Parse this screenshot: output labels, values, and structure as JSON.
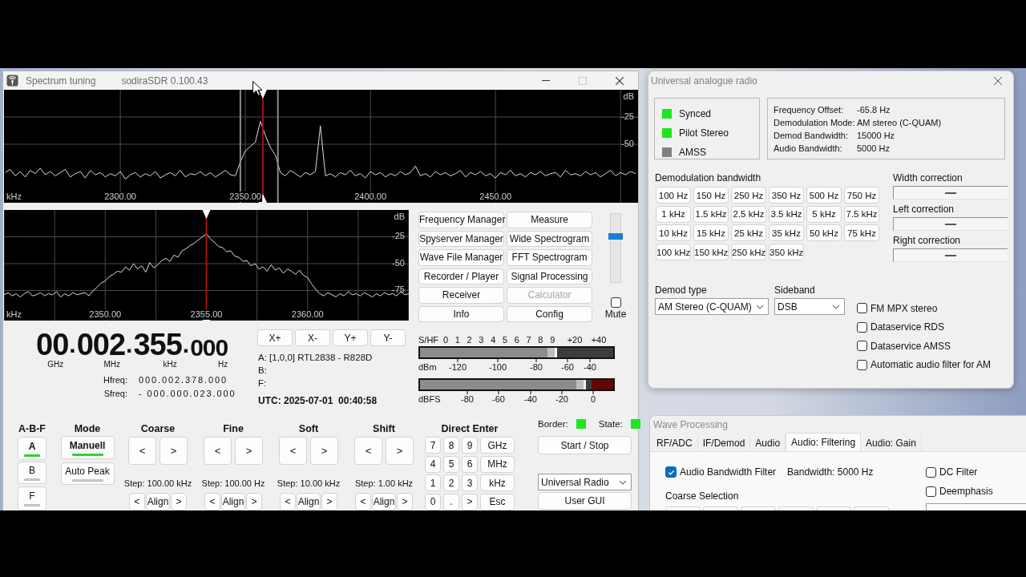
{
  "spectrum_window": {
    "title": "Spectrum tuning",
    "version": "sodiraSDR 0.100.43",
    "window_buttons": [
      {
        "kind": "minimize",
        "disabled": false
      },
      {
        "kind": "maximize",
        "disabled": true
      },
      {
        "kind": "close",
        "disabled": false
      }
    ],
    "wide_spectrum": {
      "chart_data": [
        {
          "type": "line",
          "xlabel": "kHz",
          "ylabel": "dB",
          "xlim": [
            2253.5,
            2507
          ],
          "ylim": [
            -103.7,
            0
          ],
          "xticks": [
            {
              "value": 2300,
              "label": "2300.00"
            },
            {
              "value": 2350,
              "label": "2350.00"
            },
            {
              "value": 2400,
              "label": "2400.00"
            },
            {
              "value": 2450,
              "label": "2450.00"
            }
          ],
          "yticks": [
            -25,
            -50
          ],
          "grid": true,
          "color": "#dcdcdc",
          "ref_lines": [
            {
              "axis": "x",
              "value": 2357,
              "color": "#a51212"
            },
            {
              "axis": "x",
              "value": 2348,
              "color": "#8c8c8c"
            },
            {
              "axis": "x",
              "value": 2363,
              "color": "#8c8c8c"
            }
          ],
          "x": [
            2254,
            2256,
            2258,
            2260,
            2262,
            2264,
            2266,
            2268,
            2270,
            2272,
            2274,
            2276,
            2278,
            2280,
            2282,
            2284,
            2286,
            2288,
            2290,
            2292,
            2294,
            2296,
            2298,
            2300,
            2302,
            2304,
            2306,
            2308,
            2310,
            2312,
            2314,
            2316,
            2318,
            2320,
            2322,
            2324,
            2326,
            2328,
            2330,
            2332,
            2334,
            2336,
            2338,
            2340,
            2342,
            2344,
            2346,
            2348,
            2350,
            2352,
            2354,
            2356,
            2358,
            2360,
            2362,
            2364,
            2366,
            2368,
            2370,
            2372,
            2374,
            2376,
            2378,
            2380,
            2382,
            2384,
            2386,
            2388,
            2390,
            2392,
            2394,
            2396,
            2398,
            2400,
            2402,
            2404,
            2406,
            2408,
            2410,
            2412,
            2414,
            2416,
            2418,
            2420,
            2422,
            2424,
            2426,
            2428,
            2430,
            2432,
            2434,
            2436,
            2438,
            2440,
            2442,
            2444,
            2446,
            2448,
            2450,
            2452,
            2454,
            2456,
            2458,
            2460,
            2462,
            2464,
            2466,
            2468,
            2470,
            2472,
            2474,
            2476,
            2478,
            2480,
            2482,
            2484,
            2486,
            2488,
            2490,
            2492,
            2494,
            2496,
            2498,
            2500,
            2502,
            2504,
            2506
          ],
          "values": [
            -76,
            -73,
            -79,
            -75,
            -80,
            -74,
            -77,
            -72,
            -78,
            -75,
            -79,
            -76,
            -73,
            -80,
            -77,
            -75,
            -81,
            -74,
            -78,
            -76,
            -80,
            -77,
            -79,
            -75,
            -82,
            -78,
            -76,
            -80,
            -77,
            -79,
            -75,
            -81,
            -78,
            -76,
            -79,
            -74,
            -80,
            -77,
            -78,
            -75,
            -79,
            -76,
            -80,
            -77,
            -74,
            -78,
            -79,
            -66,
            -56,
            -52,
            -48,
            -29,
            -42,
            -53,
            -60,
            -76,
            -79,
            -74,
            -77,
            -80,
            -76,
            -78,
            -75,
            -33,
            -79,
            -77,
            -80,
            -76,
            -78,
            -74,
            -79,
            -77,
            -81,
            -75,
            -78,
            -76,
            -80,
            -77,
            -79,
            -75,
            -78,
            -76,
            -70,
            -79,
            -77,
            -80,
            -75,
            -78,
            -76,
            -79,
            -77,
            -74,
            -80,
            -76,
            -78,
            -75,
            -79,
            -77,
            -81,
            -76,
            -78,
            -74,
            -79,
            -77,
            -80,
            -76,
            -78,
            -75,
            -79,
            -77,
            -76,
            -80,
            -74,
            -78,
            -77,
            -79,
            -75,
            -78,
            -76,
            -80,
            -77,
            -74,
            -79,
            -76,
            -78,
            -75,
            -77
          ]
        }
      ]
    },
    "zoom_spectrum": {
      "chart_data": [
        {
          "type": "line",
          "xlabel": "kHz",
          "ylabel": "dB",
          "xlim": [
            2345,
            2365
          ],
          "ylim": [
            -103,
            0
          ],
          "xticks": [
            {
              "value": 2350,
              "label": "2350.00"
            },
            {
              "value": 2355,
              "label": "2355.00"
            },
            {
              "value": 2360,
              "label": "2360.00"
            }
          ],
          "yticks": [
            -25,
            -50,
            -75
          ],
          "grid": true,
          "color": "#dcdcdc",
          "ref_lines": [
            {
              "axis": "x",
              "value": 2355,
              "color": "#a51212"
            }
          ],
          "x": [
            2345,
            2345.2,
            2345.4,
            2345.6,
            2345.8,
            2346,
            2346.2,
            2346.4,
            2346.6,
            2346.8,
            2347,
            2347.2,
            2347.4,
            2347.6,
            2347.8,
            2348,
            2348.2,
            2348.4,
            2348.6,
            2348.8,
            2349,
            2349.2,
            2349.4,
            2349.6,
            2349.8,
            2350,
            2350.2,
            2350.4,
            2350.6,
            2350.8,
            2351,
            2351.2,
            2351.4,
            2351.6,
            2351.8,
            2352,
            2352.2,
            2352.4,
            2352.6,
            2352.8,
            2353,
            2353.2,
            2353.4,
            2353.6,
            2353.8,
            2354,
            2354.2,
            2354.4,
            2354.6,
            2354.8,
            2355,
            2355.2,
            2355.4,
            2355.6,
            2355.8,
            2356,
            2356.2,
            2356.4,
            2356.6,
            2356.8,
            2357,
            2357.2,
            2357.4,
            2357.6,
            2357.8,
            2358,
            2358.2,
            2358.4,
            2358.6,
            2358.8,
            2359,
            2359.2,
            2359.4,
            2359.6,
            2359.8,
            2360,
            2360.2,
            2360.4,
            2360.6,
            2360.8,
            2361,
            2361.2,
            2361.4,
            2361.6,
            2361.8,
            2362,
            2362.2,
            2362.4,
            2362.6,
            2362.8,
            2363,
            2363.2,
            2363.4,
            2363.6,
            2363.8,
            2364,
            2364.2,
            2364.4,
            2364.6,
            2364.8,
            2365
          ],
          "values": [
            -79,
            -77,
            -80,
            -78,
            -81,
            -78,
            -76,
            -80,
            -79,
            -77,
            -80,
            -78,
            -79,
            -76,
            -81,
            -78,
            -80,
            -77,
            -79,
            -78,
            -77,
            -80,
            -75,
            -72,
            -68,
            -66,
            -62,
            -60,
            -57,
            -58,
            -53,
            -56,
            -50,
            -55,
            -52,
            -58,
            -49,
            -54,
            -51,
            -47,
            -45,
            -48,
            -42,
            -44,
            -38,
            -36,
            -33,
            -31,
            -28,
            -25,
            -22,
            -27,
            -30,
            -34,
            -35,
            -39,
            -38,
            -43,
            -44,
            -48,
            -47,
            -52,
            -50,
            -55,
            -53,
            -57,
            -51,
            -56,
            -54,
            -59,
            -55,
            -57,
            -60,
            -56,
            -61,
            -63,
            -69,
            -74,
            -78,
            -80,
            -77,
            -79,
            -81,
            -78,
            -80,
            -76,
            -79,
            -78,
            -80,
            -77,
            -79,
            -81,
            -78,
            -80,
            -77,
            -79,
            -78,
            -80,
            -76,
            -79,
            -78
          ]
        }
      ]
    },
    "tool_buttons": [
      {
        "label": "Frequency Manager",
        "disabled": false
      },
      {
        "label": "Measure",
        "disabled": false
      },
      {
        "label": "Spyserver Manager",
        "disabled": false
      },
      {
        "label": "Wide Spectrogram",
        "disabled": false
      },
      {
        "label": "Wave File Manager",
        "disabled": false
      },
      {
        "label": "FFT Spectrogram",
        "disabled": false
      },
      {
        "label": "Recorder / Player",
        "disabled": false
      },
      {
        "label": "Signal Processing",
        "disabled": false
      },
      {
        "label": "Receiver",
        "disabled": false
      },
      {
        "label": "Calculator",
        "disabled": true
      },
      {
        "label": "Info",
        "disabled": false
      },
      {
        "label": "Config",
        "disabled": false
      }
    ],
    "volume": {
      "level": 0.7
    },
    "mute": {
      "label": "Mute",
      "checked": false
    },
    "frequency": [
      {
        "digits": "00",
        "separator": ".",
        "unit": "GHz"
      },
      {
        "digits": "002",
        "separator": ".",
        "unit": "MHz"
      },
      {
        "digits": "355",
        "separator": ".",
        "unit": "kHz"
      },
      {
        "digits": "000",
        "unit": "Hz"
      }
    ],
    "offsets": [
      {
        "label": "Hfreq:",
        "value": "000.002.378.000"
      },
      {
        "label": "Sfreq:",
        "value": "- 000.000.023.000"
      }
    ],
    "axis_buttons": [
      "X+",
      "X-",
      "Y+",
      "Y-"
    ],
    "devices": [
      "A: [1,0,0] RTL2838 - R828D",
      "B:",
      "F:"
    ],
    "utc": "UTC: 2025-07-01  00:40:58",
    "meters": [
      {
        "kind": "dbm",
        "scale_unit": "S/HF",
        "scale": [
          "0",
          "1",
          "2",
          "3",
          "4",
          "5",
          "6",
          "7",
          "8",
          "9",
          "+20",
          "+40"
        ],
        "unit": "dBm",
        "labels": [
          "-120",
          "-100",
          "-80",
          "-60",
          "-40"
        ],
        "level": 0.71
      },
      {
        "kind": "dbfs",
        "unit": "dBFS",
        "labels": [
          "-80",
          "-60",
          "-40",
          "-20",
          "0"
        ],
        "level": 0.86
      }
    ],
    "vfo": {
      "title": "A-B-F",
      "buttons": [
        {
          "label": "A",
          "selected": true
        },
        {
          "label": "B",
          "selected": false
        },
        {
          "label": "F",
          "selected": false
        }
      ]
    },
    "mode": {
      "title": "Mode",
      "buttons": [
        {
          "label": "Manuell",
          "selected": true
        },
        {
          "label": "Auto Peak",
          "selected": false
        }
      ]
    },
    "steppers": [
      {
        "title": "Coarse",
        "arrows": [
          "<",
          ">"
        ],
        "step": "Step: 100.00 kHz",
        "nudge": [
          "<",
          "Align",
          ">"
        ]
      },
      {
        "title": "Fine",
        "arrows": [
          "<",
          ">"
        ],
        "step": "Step: 100.00 Hz",
        "nudge": [
          "<",
          "Align",
          ">"
        ]
      },
      {
        "title": "Soft",
        "arrows": [
          "<",
          ">"
        ],
        "step": "Step: 10.00 kHz",
        "nudge": [
          "<",
          "Align",
          ">"
        ]
      },
      {
        "title": "Shift",
        "arrows": [
          "<",
          ">"
        ],
        "step": "Step: 1.00 kHz",
        "nudge": [
          "<",
          "Align",
          ">"
        ]
      }
    ],
    "direct_enter": {
      "title": "Direct Enter",
      "keys": [
        "7",
        "8",
        "9",
        "GHz",
        "4",
        "5",
        "6",
        "MHz",
        "1",
        "2",
        "3",
        "kHz",
        "0",
        ".",
        ">",
        "Esc"
      ]
    },
    "indicators": [
      {
        "label": "Border:",
        "color": "#1ee61e"
      },
      {
        "label": "State:",
        "color": "#1ee61e"
      }
    ],
    "start_stop": "Start / Stop",
    "receiver": "Universal Radio",
    "user_gui": "User GUI"
  },
  "radio_window": {
    "title": "Universal analogue radio",
    "status": [
      {
        "label": "Synced",
        "color": "#1ee61e"
      },
      {
        "label": "Pilot Stereo",
        "color": "#1ee61e"
      },
      {
        "label": "AMSS",
        "color": "#808080"
      }
    ],
    "info": [
      {
        "label": "Frequency Offset:",
        "value": "-65.8 Hz"
      },
      {
        "label": "Demodulation Mode:",
        "value": "AM stereo (C-QUAM)"
      },
      {
        "label": "Demod Bandwidth:",
        "value": "15000 Hz"
      },
      {
        "label": "Audio Bandwidth:",
        "value": "5000 Hz"
      }
    ],
    "bandwidth_title": "Demodulation bandwidth",
    "bandwidth_buttons": [
      "100 Hz",
      "150 Hz",
      "250 Hz",
      "350 Hz",
      "500 Hz",
      "750 Hz",
      "1 kHz",
      "1.5 kHz",
      "2.5 kHz",
      "3.5 kHz",
      "5 kHz",
      "7.5 kHz",
      "10 kHz",
      "15 kHz",
      "25 kHz",
      "35 kHz",
      "50 kHz",
      "75 kHz",
      "100 kHz",
      "150 kHz",
      "250 kHz",
      "350 kHz"
    ],
    "corrections": [
      {
        "label": "Width correction",
        "level": 0.5
      },
      {
        "label": "Left correction",
        "level": 0.5
      },
      {
        "label": "Right correction",
        "level": 0.5
      }
    ],
    "demod_type": {
      "label": "Demod type",
      "value": "AM Stereo (C-QUAM)"
    },
    "sideband": {
      "label": "Sideband",
      "value": "DSB"
    },
    "options": [
      {
        "label": "FM MPX stereo",
        "checked": false
      },
      {
        "label": "Dataservice RDS",
        "checked": false
      },
      {
        "label": "Dataservice AMSS",
        "checked": false
      },
      {
        "label": "Automatic audio filter for AM",
        "checked": false
      }
    ]
  },
  "wave_window": {
    "title": "Wave Processing",
    "tabs": [
      {
        "label": "RF/ADC",
        "selected": false
      },
      {
        "label": "IF/Demod",
        "selected": false
      },
      {
        "label": "Audio",
        "selected": false
      },
      {
        "label": "Audio: Filtering",
        "selected": true
      },
      {
        "label": "Audio: Gain",
        "selected": false
      }
    ],
    "bandwidth_filter": {
      "label": "Audio Bandwidth Filter",
      "checked": true
    },
    "bandwidth": "Bandwidth: 5000 Hz",
    "coarse_title": "Coarse Selection",
    "filters": [
      {
        "label": "DC Filter",
        "checked": false
      },
      {
        "label": "Deemphasis",
        "checked": false
      }
    ]
  }
}
